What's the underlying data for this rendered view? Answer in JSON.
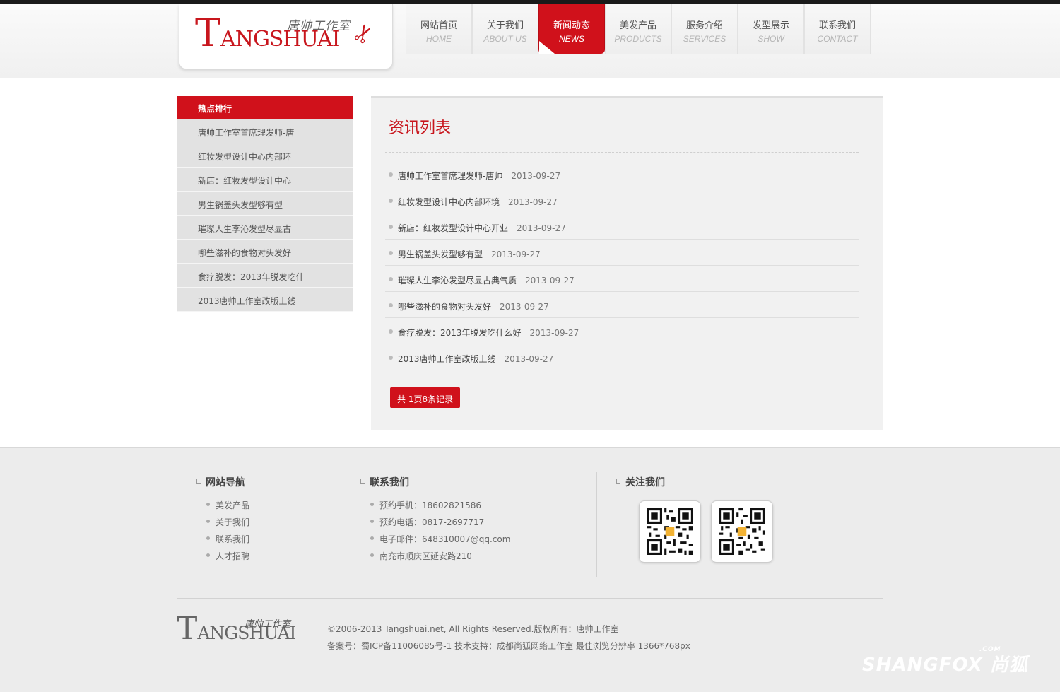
{
  "header": {
    "logo_main": "T",
    "logo_rest": "ANGSHUAI",
    "logo_cn": "唐帅工作室",
    "nav": [
      {
        "cn": "网站首页",
        "en": "HOME",
        "active": false
      },
      {
        "cn": "关于我们",
        "en": "ABOUT US",
        "active": false
      },
      {
        "cn": "新闻动态",
        "en": "NEWS",
        "active": true
      },
      {
        "cn": "美发产品",
        "en": "PRODUCTS",
        "active": false
      },
      {
        "cn": "服务介绍",
        "en": "SERVICES",
        "active": false
      },
      {
        "cn": "发型展示",
        "en": "SHOW",
        "active": false
      },
      {
        "cn": "联系我们",
        "en": "CONTACT",
        "active": false
      }
    ]
  },
  "sidebar": {
    "title": "热点排行",
    "items": [
      "唐帅工作室首席理发师-唐",
      "红妆发型设计中心内部环",
      "新店：红妆发型设计中心",
      "男生锅盖头发型够有型",
      "璀璨人生李沁发型尽显古",
      "哪些滋补的食物对头发好",
      "食疗脱发：2013年脱发吃什",
      "2013唐帅工作室改版上线"
    ]
  },
  "main": {
    "title": "资讯列表",
    "news": [
      {
        "title": "唐帅工作室首席理发师-唐帅",
        "date": "2013-09-27"
      },
      {
        "title": "红妆发型设计中心内部环境",
        "date": "2013-09-27"
      },
      {
        "title": "新店：红妆发型设计中心开业",
        "date": "2013-09-27"
      },
      {
        "title": "男生锅盖头发型够有型",
        "date": "2013-09-27"
      },
      {
        "title": "璀璨人生李沁发型尽显古典气质",
        "date": "2013-09-27"
      },
      {
        "title": "哪些滋补的食物对头发好",
        "date": "2013-09-27"
      },
      {
        "title": "食疗脱发：2013年脱发吃什么好",
        "date": "2013-09-27"
      },
      {
        "title": "2013唐帅工作室改版上线",
        "date": "2013-09-27"
      }
    ],
    "pager": "共 1页8条记录"
  },
  "footer": {
    "nav_title": "网站导航",
    "nav_items": [
      "美发产品",
      "关于我们",
      "联系我们",
      "人才招聘"
    ],
    "contact_title": "联系我们",
    "contact_items": [
      "预约手机：18602821586",
      "预约电话：0817-2697717",
      "电子邮件：648310007@qq.com",
      "南充市顺庆区延安路210"
    ],
    "follow_title": "关注我们",
    "logo_main": "T",
    "logo_rest": "ANGSHUAI",
    "logo_cn": "唐帅工作室",
    "copyright": "©2006-2013 Tangshuai.net, All Rights Reserved.版权所有：唐帅工作室",
    "icp": "备案号：蜀ICP备11006085号-1 技术支持：成都尚狐网络工作室   最佳浏览分辨率 1366*768px"
  },
  "watermark": {
    "text": "SHANGFOX 尚狐",
    "small": ".COM"
  }
}
